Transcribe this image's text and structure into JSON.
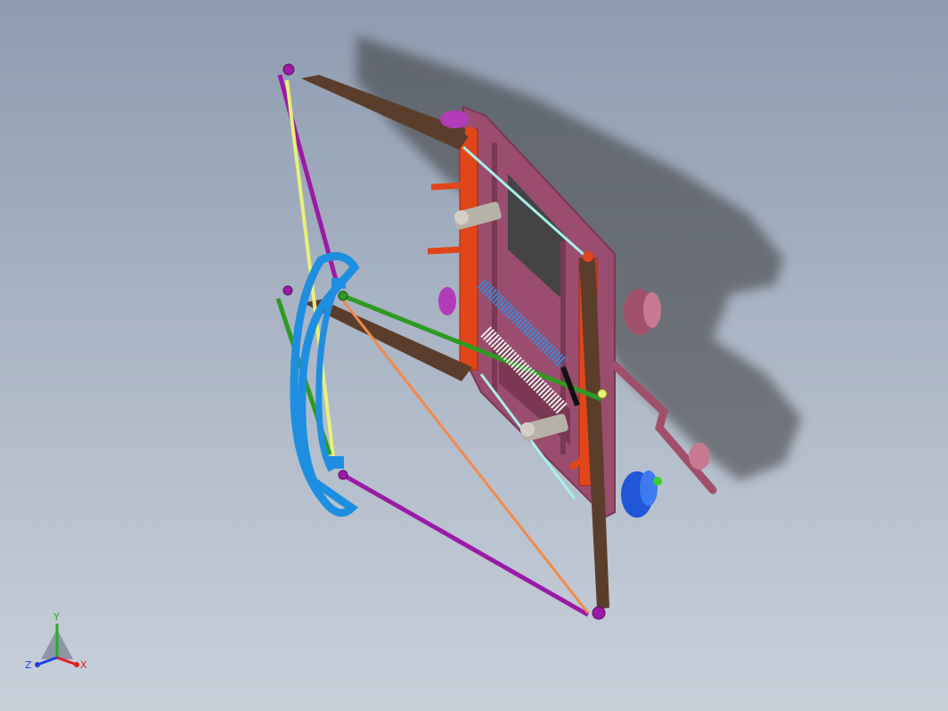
{
  "viewport": {
    "name": "3D model view",
    "background_top": "#8e9cb0",
    "background_bottom": "#c8d0da"
  },
  "model": {
    "colors": {
      "frame_plate": "#9a4d6e",
      "frame_plate_dark": "#7a3852",
      "orange_post": "#e0461a",
      "brown_bar": "#5a3e2b",
      "purple_rod": "#9b1aa6",
      "yellow_rod": "#e9f07a",
      "green_rod": "#2f9a22",
      "orange_rod": "#f08a4a",
      "cyan_rod": "#a8f0ec",
      "blue_handle": "#1e8fe0",
      "blue_spring": "#3a8ad8",
      "white_spring": "#eeeeee",
      "gray_bracket": "#b7b2a8",
      "pink_pulley": "#a0506a",
      "blue_pulley": "#1f57d8",
      "shadow": "#3a3a3a"
    }
  },
  "triad": {
    "y_label": "Y",
    "x_label": "X",
    "z_label": "Z",
    "x_color": "#e02020",
    "y_color": "#22b022",
    "z_color": "#2040e0"
  }
}
